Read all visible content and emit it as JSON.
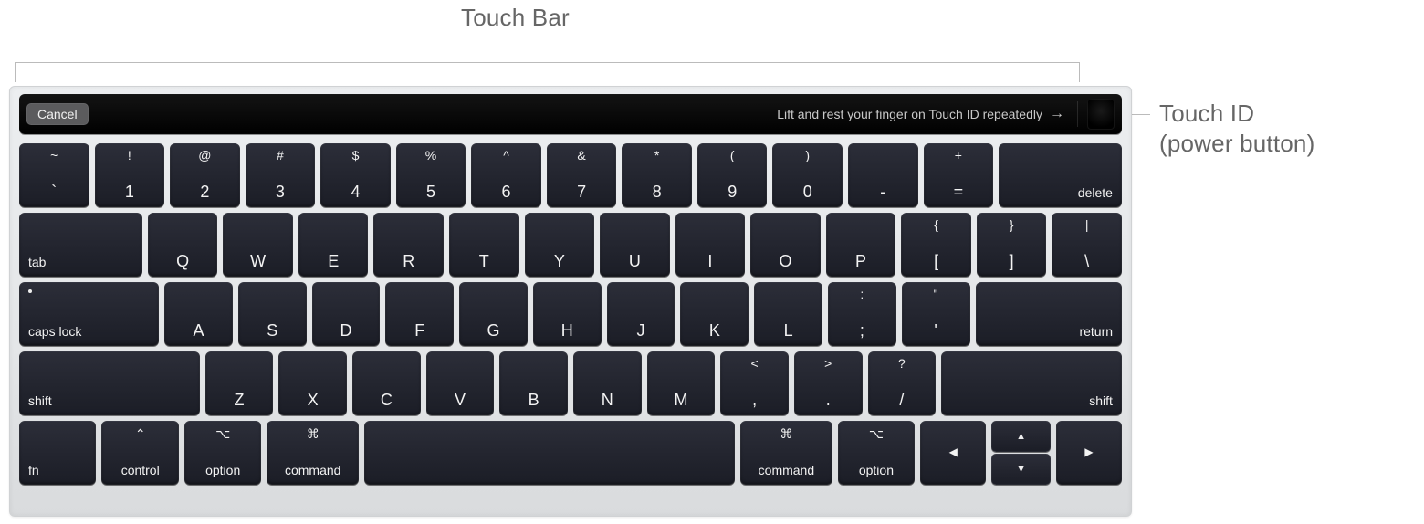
{
  "labels": {
    "touchbar": "Touch Bar",
    "touchid_line1": "Touch ID",
    "touchid_line2": "(power button)"
  },
  "touchbar": {
    "cancel": "Cancel",
    "message": "Lift and rest your finger on Touch ID repeatedly"
  },
  "rows": {
    "r1": [
      {
        "top": "~",
        "bot": "`"
      },
      {
        "top": "!",
        "bot": "1"
      },
      {
        "top": "@",
        "bot": "2"
      },
      {
        "top": "#",
        "bot": "3"
      },
      {
        "top": "$",
        "bot": "4"
      },
      {
        "top": "%",
        "bot": "5"
      },
      {
        "top": "^",
        "bot": "6"
      },
      {
        "top": "&",
        "bot": "7"
      },
      {
        "top": "*",
        "bot": "8"
      },
      {
        "top": "(",
        "bot": "9"
      },
      {
        "top": ")",
        "bot": "0"
      },
      {
        "top": "_",
        "bot": "-"
      },
      {
        "top": "+",
        "bot": "="
      }
    ],
    "r1_delete": "delete",
    "r2_tab": "tab",
    "r2": [
      "Q",
      "W",
      "E",
      "R",
      "T",
      "Y",
      "U",
      "I",
      "O",
      "P"
    ],
    "r2_brackets": [
      {
        "top": "{",
        "bot": "["
      },
      {
        "top": "}",
        "bot": "]"
      },
      {
        "top": "|",
        "bot": "\\"
      }
    ],
    "r3_caps": "caps lock",
    "r3": [
      "A",
      "S",
      "D",
      "F",
      "G",
      "H",
      "J",
      "K",
      "L"
    ],
    "r3_punct": [
      {
        "top": ":",
        "bot": ";"
      },
      {
        "top": "\"",
        "bot": "'"
      }
    ],
    "r3_return": "return",
    "r4_shiftL": "shift",
    "r4": [
      "Z",
      "X",
      "C",
      "V",
      "B",
      "N",
      "M"
    ],
    "r4_punct": [
      {
        "top": "<",
        "bot": ","
      },
      {
        "top": ">",
        "bot": "."
      },
      {
        "top": "?",
        "bot": "/"
      }
    ],
    "r4_shiftR": "shift",
    "r5_fn": "fn",
    "r5_ctrl": "control",
    "r5_optL": "option",
    "r5_cmdL": "command",
    "r5_cmdR": "command",
    "r5_optR": "option",
    "glyphs": {
      "ctrl": "⌃",
      "opt": "⌥",
      "cmd": "⌘"
    },
    "arrows": {
      "left": "◀",
      "up": "▲",
      "down": "▼",
      "right": "▶"
    }
  }
}
